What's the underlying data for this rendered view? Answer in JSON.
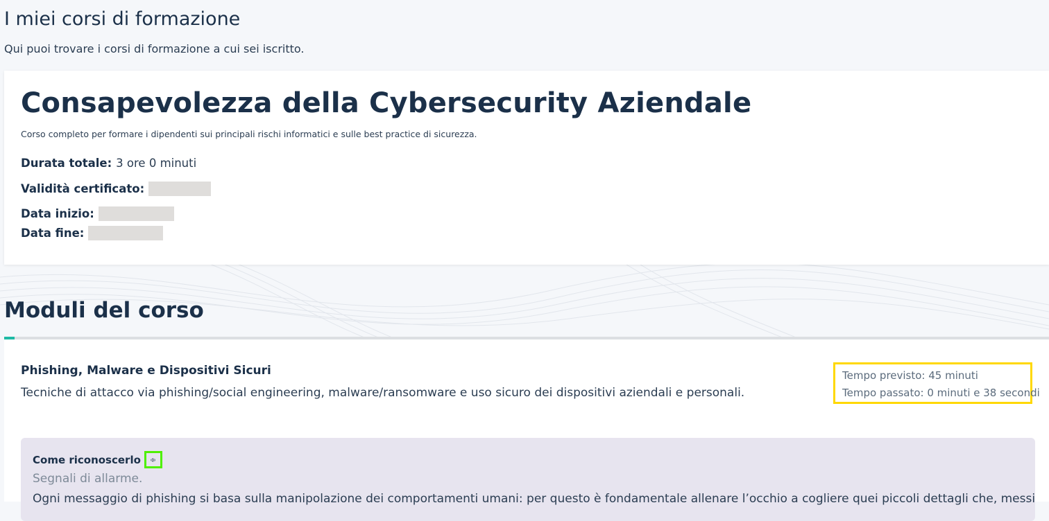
{
  "page": {
    "title": "I miei corsi di formazione",
    "subtitle": "Qui puoi trovare i corsi di formazione a cui sei iscritto."
  },
  "course": {
    "title": "Consapevolezza della Cybersecurity Aziendale",
    "description": "Corso completo per formare i dipendenti sui principali rischi informatici e sulle best practice di sicurezza.",
    "duration_label": "Durata totale:",
    "duration_value": "3 ore 0 minuti",
    "certificate_label": "Validità certificato:",
    "start_label": "Data inizio:",
    "end_label": "Data fine:"
  },
  "modules": {
    "section_title": "Moduli del corso",
    "items": [
      {
        "title": "Phishing, Malware e Dispositivi Sicuri",
        "description": "Tecniche di attacco via phishing/social engineering, malware/ransomware e uso sicuro dei dispositivi aziendali e personali.",
        "expected_time": "Tempo previsto: 45 minuti",
        "elapsed_time": "Tempo passato: 0 minuti e 38 secondi",
        "lesson": {
          "title": "Come riconoscerlo",
          "subtitle": "Segnali di allarme.",
          "text": "Ogni messaggio di phishing si basa sulla manipolazione dei comportamenti umani: per questo è fondamentale allenare l’occhio a cogliere quei piccoli dettagli che, messi"
        }
      }
    ]
  },
  "icons": {
    "audio": "speaker-icon"
  },
  "colors": {
    "accent": "#1ebaa5",
    "highlight_time": "#ffd800",
    "highlight_audio": "#4ff000",
    "lesson_bg": "#e7e4ef",
    "text_dark": "#1b3049"
  }
}
